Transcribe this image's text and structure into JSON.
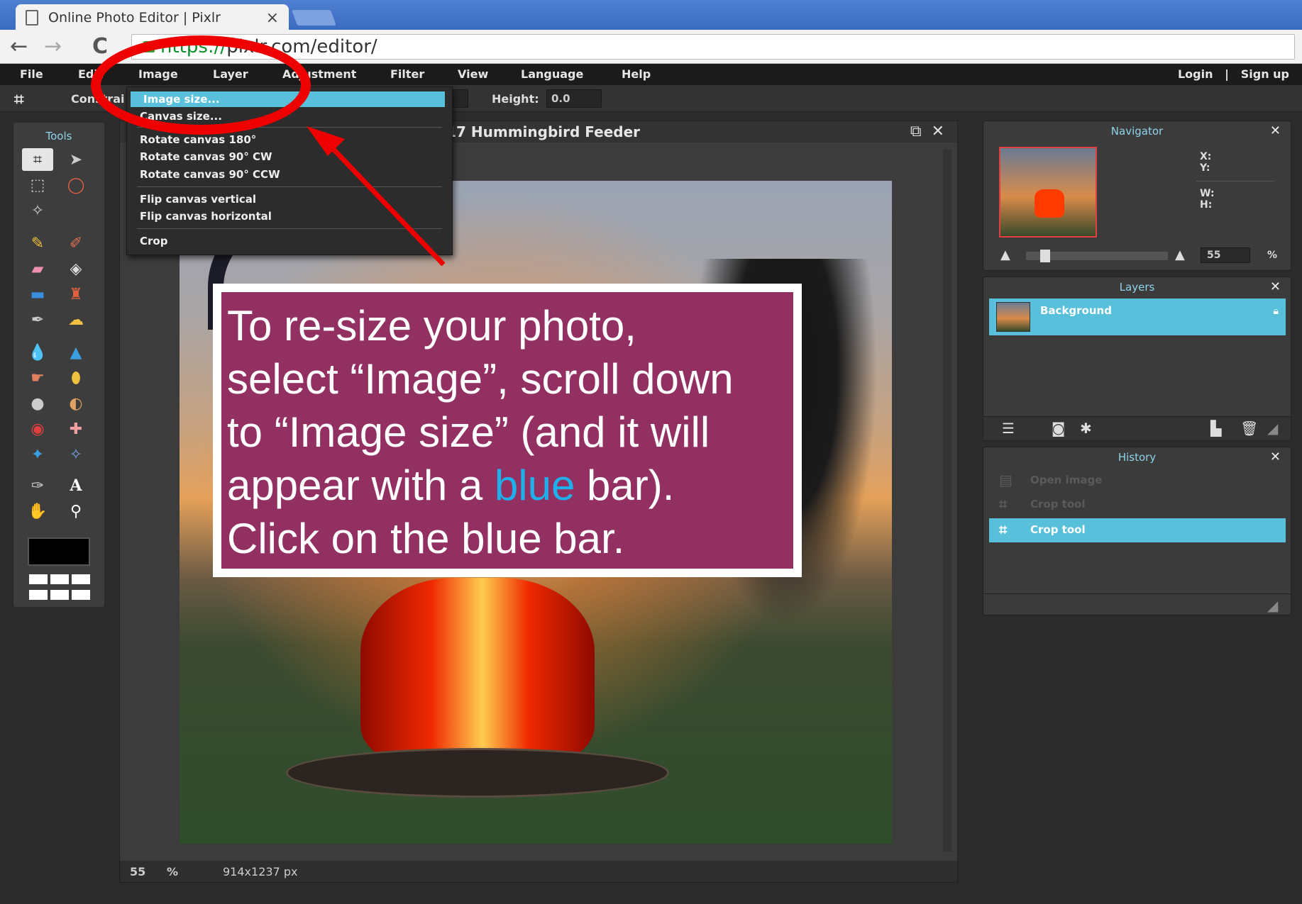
{
  "browser": {
    "tab_title": "Online Photo Editor | Pixlr",
    "tab_close": "×",
    "url_scheme": "https://",
    "url_rest": "pixlr.com/editor/",
    "back": "←",
    "forward": "→",
    "reload": "C"
  },
  "menubar": {
    "items": [
      "File",
      "Edit",
      "Image",
      "Layer",
      "Adjustment",
      "Filter",
      "View",
      "Language",
      "Help"
    ],
    "login": "Login",
    "sep": "|",
    "signup": "Sign up"
  },
  "options": {
    "constrain": "Constrai",
    "height_label": "Height:",
    "height_value": "0.0"
  },
  "tools": {
    "title": "Tools"
  },
  "image_menu": {
    "items": [
      "Image size...",
      "Canvas size...",
      "Rotate canvas 180°",
      "Rotate canvas 90° CW",
      "Rotate canvas 90° CCW",
      "Flip canvas vertical",
      "Flip canvas horizontal",
      "Crop"
    ]
  },
  "document": {
    "title": "2017-01-17 Hummingbird Feeder",
    "zoom": "55",
    "zoom_unit": "%",
    "dimensions": "914x1237 px"
  },
  "navigator": {
    "title": "Navigator",
    "x_label": "X:",
    "y_label": "Y:",
    "w_label": "W:",
    "h_label": "H:",
    "zoom_value": "55",
    "zoom_unit": "%"
  },
  "layers": {
    "title": "Layers",
    "items": [
      "Background"
    ]
  },
  "history": {
    "title": "History",
    "items": [
      "Open image",
      "Crop tool",
      "Crop tool"
    ]
  },
  "callout": {
    "line1": "To re-size your photo,",
    "line2": "select “Image”, scroll down",
    "line3": "to “Image size” (and it will",
    "line4a": "appear with a ",
    "line4b": "blue",
    "line4c": " bar).",
    "line5": "Click on the blue bar."
  },
  "colors": {
    "accent": "#58c0da",
    "callout_bg": "#933062",
    "annotation_red": "#ef0000"
  }
}
